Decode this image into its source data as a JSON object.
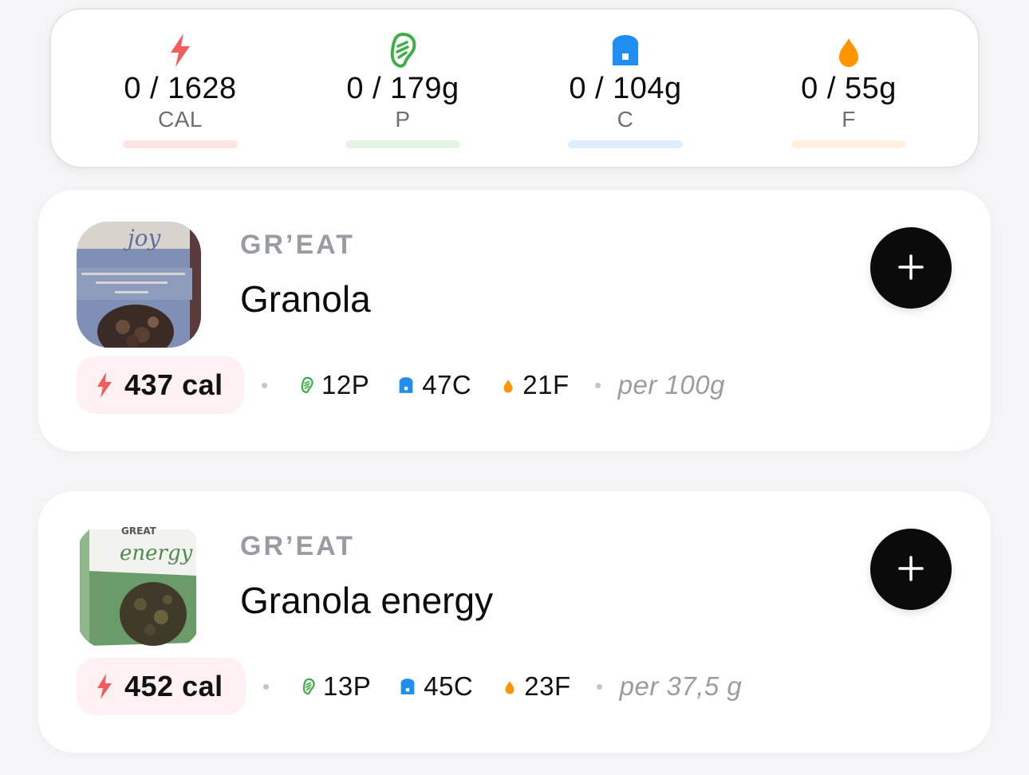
{
  "summary": {
    "calories": {
      "value": "0 / 1628",
      "label": "CAL",
      "icon": "bolt-icon",
      "color": "#f25c5c",
      "bar_color": "#fde3e3",
      "progress": 0
    },
    "protein": {
      "value": "0 / 179g",
      "label": "P",
      "icon": "meat-icon",
      "color": "#3fae49",
      "bar_color": "#e3f3e4",
      "progress": 0
    },
    "carbs": {
      "value": "0 / 104g",
      "label": "C",
      "icon": "bread-icon",
      "color": "#1f8ef1",
      "bar_color": "#dfedfb",
      "progress": 0
    },
    "fat": {
      "value": "0 / 55g",
      "label": "F",
      "icon": "drop-icon",
      "color": "#ff9500",
      "bar_color": "#fdf0dc",
      "progress": 0
    }
  },
  "foods": [
    {
      "brand": "GR’EAT",
      "name": "Granola",
      "thumbnail": "granola-joy-package",
      "package_text": "joy",
      "calories": "437 cal",
      "protein": "12P",
      "carbs": "47C",
      "fat": "21F",
      "serving": "per 100g",
      "add_icon": "plus-icon"
    },
    {
      "brand": "GR’EAT",
      "name": "Granola energy",
      "thumbnail": "granola-energy-package",
      "package_text": "energy",
      "calories": "452 cal",
      "protein": "13P",
      "carbs": "45C",
      "fat": "23F",
      "serving": "per 37,5 g",
      "add_icon": "plus-icon"
    }
  ]
}
